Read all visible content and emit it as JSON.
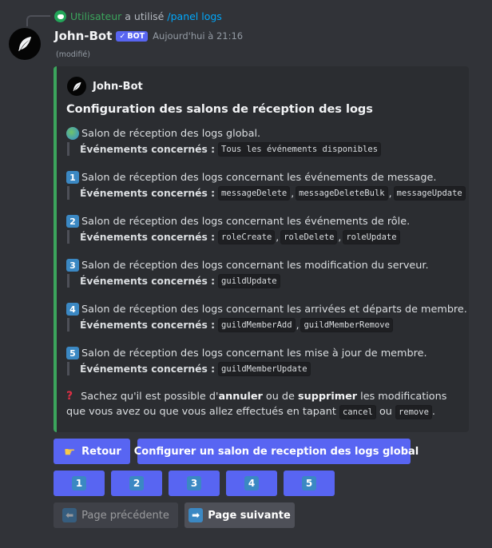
{
  "reply": {
    "user": "Utilisateur",
    "text": "a utilisé",
    "command": "/panel logs"
  },
  "message": {
    "author": "John-Bot",
    "badge": "BOT",
    "timestamp": "Aujourd'hui à 21:16",
    "edited": "(modifié)"
  },
  "embed": {
    "author": "John-Bot",
    "title": "Configuration des salons de réception des logs",
    "accent_color": "#3ba55c",
    "events_label": "Événements concernés :",
    "sections": [
      {
        "emoji": "globe",
        "text": "Salon de réception des logs global.",
        "events": [
          "Tous les événements disponibles"
        ]
      },
      {
        "emoji": "1",
        "text": "Salon de réception des logs concernant les événements de message.",
        "events": [
          "messageDelete",
          "messageDeleteBulk",
          "messageUpdate"
        ]
      },
      {
        "emoji": "2",
        "text": "Salon de réception des logs concernant les événements de rôle.",
        "events": [
          "roleCreate",
          "roleDelete",
          "roleUpdate"
        ]
      },
      {
        "emoji": "3",
        "text": "Salon de réception des logs concernant les modification du serveur.",
        "events": [
          "guildUpdate"
        ]
      },
      {
        "emoji": "4",
        "text": "Salon de réception des logs concernant les arrivées et départs de membre.",
        "events": [
          "guildMemberAdd",
          "guildMemberRemove"
        ]
      },
      {
        "emoji": "5",
        "text": "Salon de réception des logs concernant les mise à jour de membre.",
        "events": [
          "guildMemberUpdate"
        ]
      }
    ],
    "note": {
      "part1": "Sachez qu'il est possible d'",
      "bold1": "annuler",
      "part2": " ou de ",
      "bold2": "supprimer",
      "part3": " les modifications que vous avez ou que vous allez effectués en tapant ",
      "code1": "cancel",
      "part4": " ou ",
      "code2": "remove",
      "part5": "."
    }
  },
  "buttons": {
    "back": "Retour",
    "global": "Configurer un salon de reception des logs global",
    "numbers": [
      "1",
      "2",
      "3",
      "4",
      "5"
    ],
    "prev": "Page précédente",
    "next": "Page suivante"
  },
  "colors": {
    "background": "#313338",
    "embed_bg": "#2b2d31",
    "blurple": "#5865f2",
    "secondary": "#4e5058"
  }
}
